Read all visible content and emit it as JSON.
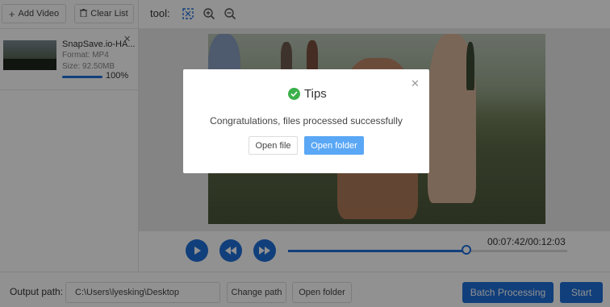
{
  "sidebar": {
    "add_video_label": "Add Video",
    "clear_list_label": "Clear List",
    "file": {
      "name": "SnapSave.io-HA...",
      "format": "Format:  MP4",
      "size": "Size:  92.50MB",
      "progress_label": "100%",
      "progress": 1.0
    }
  },
  "toolbar": {
    "tool_label": "tool:"
  },
  "player": {
    "time": "00:07:42/00:12:03",
    "seek_progress": 0.64
  },
  "bottom": {
    "output_label": "Output path:",
    "output_path": "C:\\Users\\lyesking\\Desktop",
    "change_path_label": "Change path",
    "open_folder_label": "Open folder",
    "batch_label": "Batch Processing",
    "start_label": "Start"
  },
  "dialog": {
    "title": "Tips",
    "message": "Congratulations, files processed successfully",
    "open_file_label": "Open file",
    "open_folder_label": "Open folder",
    "close_icon": "close-icon"
  },
  "colors": {
    "accent": "#1e6fd9",
    "dialog_primary": "#5aa7f5",
    "success": "#3cb04a"
  }
}
